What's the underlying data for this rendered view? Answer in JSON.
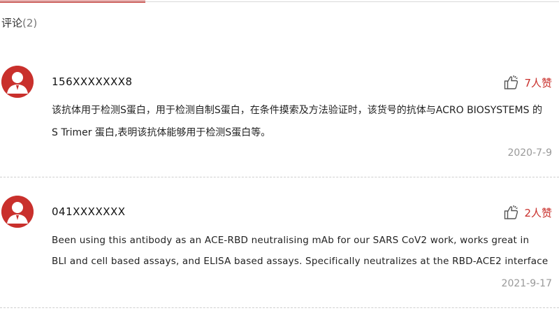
{
  "tabs": {
    "accent_color": "#c9302c"
  },
  "comments_section": {
    "title": "评论",
    "count": "(2)"
  },
  "comments": [
    {
      "username": "156XXXXXXX8",
      "likes_label": "7人赞",
      "text_lines": [
        "该抗体用于检测S蛋白，用于检测自制S蛋白，在条件摸索及方法验证时，该货号的抗体与ACRO BIOSYSTEMS 的",
        "S Trimer 蛋白,表明该抗体能够用于检测S蛋白等。"
      ],
      "date": "2020-7-9"
    },
    {
      "username": "041XXXXXXX",
      "likes_label": "2人赞",
      "text_lines": [
        "Been using this antibody as an ACE-RBD neutralising mAb for our SARS CoV2 work, works great in",
        "BLI and cell based assays, and ELISA based assays. Specifically neutralizes at the RBD-ACE2 interface"
      ],
      "date": "2021-9-17"
    }
  ],
  "icons": {
    "avatar": "user-avatar-icon",
    "like": "thumbs-up-icon"
  },
  "colors": {
    "accent": "#c9302c",
    "muted": "#999999"
  }
}
